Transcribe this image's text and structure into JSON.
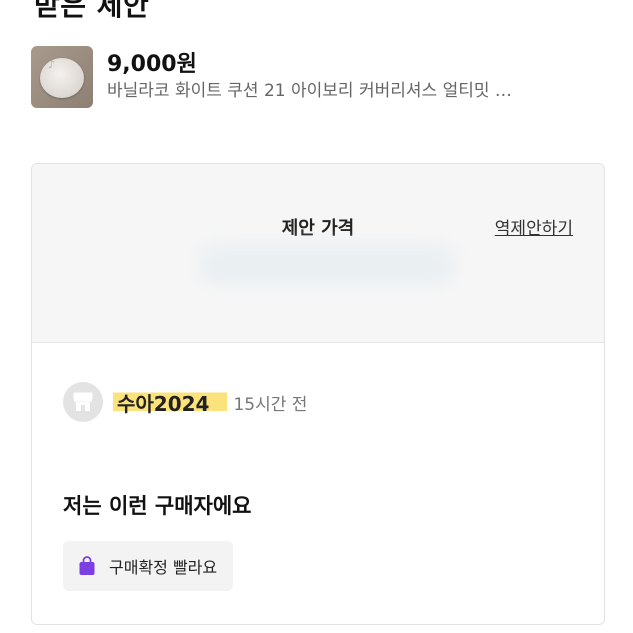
{
  "header": {
    "title": "받은 제안"
  },
  "product": {
    "price": "9,000원",
    "name": "바닐라코 화이트 쿠션 21 아이보리 커버리셔스 얼티밋 …"
  },
  "offer": {
    "price_label": "제안 가격",
    "counter_offer_label": "역제안하기"
  },
  "buyer": {
    "name": "수아2024",
    "time": "15시간 전",
    "heading": "저는 이런 구매자에요",
    "badge_label": "구매확정 빨라요"
  },
  "colors": {
    "highlight": "#fbe27a",
    "badge_icon": "#7b3fe4",
    "card_header_bg": "#f6f6f6"
  },
  "icons": {
    "buyer_avatar": "shop-icon",
    "badge": "shopping-bag-icon"
  }
}
